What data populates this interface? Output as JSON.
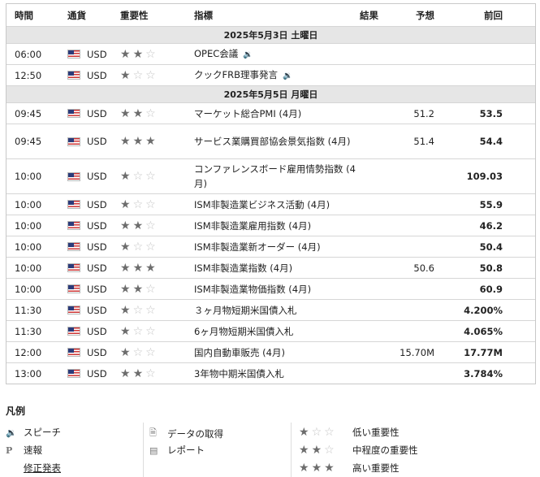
{
  "headers": {
    "time": "時間",
    "currency": "通貨",
    "importance": "重要性",
    "indicator": "指標",
    "result": "結果",
    "forecast": "予想",
    "previous": "前回"
  },
  "groups": [
    {
      "date": "2025年5月3日 土曜日",
      "rows": [
        {
          "time": "06:00",
          "currency": "USD",
          "stars": 2,
          "indicator": "OPEC会議",
          "speech": true,
          "result": "",
          "forecast": "",
          "previous": ""
        },
        {
          "time": "12:50",
          "currency": "USD",
          "stars": 1,
          "indicator": "クックFRB理事発言",
          "speech": true,
          "result": "",
          "forecast": "",
          "previous": ""
        }
      ]
    },
    {
      "date": "2025年5月5日 月曜日",
      "rows": [
        {
          "time": "09:45",
          "currency": "USD",
          "stars": 2,
          "indicator": "マーケット総合PMI (4月)",
          "result": "",
          "forecast": "51.2",
          "previous": "53.5"
        },
        {
          "time": "09:45",
          "currency": "USD",
          "stars": 3,
          "indicator": "サービス業購買部協会景気指数 (4月)",
          "result": "",
          "forecast": "51.4",
          "previous": "54.4",
          "tall": true
        },
        {
          "time": "10:00",
          "currency": "USD",
          "stars": 1,
          "indicator": "コンファレンスボード雇用情勢指数 (4月)",
          "result": "",
          "forecast": "",
          "previous": "109.03",
          "tall": true
        },
        {
          "time": "10:00",
          "currency": "USD",
          "stars": 1,
          "indicator": "ISM非製造業ビジネス活動 (4月)",
          "result": "",
          "forecast": "",
          "previous": "55.9"
        },
        {
          "time": "10:00",
          "currency": "USD",
          "stars": 2,
          "indicator": "ISM非製造業雇用指数 (4月)",
          "result": "",
          "forecast": "",
          "previous": "46.2"
        },
        {
          "time": "10:00",
          "currency": "USD",
          "stars": 1,
          "indicator": "ISM非製造業新オーダー (4月)",
          "result": "",
          "forecast": "",
          "previous": "50.4"
        },
        {
          "time": "10:00",
          "currency": "USD",
          "stars": 3,
          "indicator": "ISM非製造業指数 (4月)",
          "result": "",
          "forecast": "50.6",
          "previous": "50.8"
        },
        {
          "time": "10:00",
          "currency": "USD",
          "stars": 2,
          "indicator": "ISM非製造業物価指数 (4月)",
          "result": "",
          "forecast": "",
          "previous": "60.9"
        },
        {
          "time": "11:30",
          "currency": "USD",
          "stars": 1,
          "indicator": "３ヶ月物短期米国債入札",
          "result": "",
          "forecast": "",
          "previous": "4.200%"
        },
        {
          "time": "11:30",
          "currency": "USD",
          "stars": 1,
          "indicator": "6ヶ月物短期米国債入札",
          "result": "",
          "forecast": "",
          "previous": "4.065%"
        },
        {
          "time": "12:00",
          "currency": "USD",
          "stars": 1,
          "indicator": "国内自動車販売 (4月)",
          "result": "",
          "forecast": "15.70M",
          "previous": "17.77M"
        },
        {
          "time": "13:00",
          "currency": "USD",
          "stars": 2,
          "indicator": "3年物中期米国債入札",
          "result": "",
          "forecast": "",
          "previous": "3.784%"
        }
      ]
    }
  ],
  "legend": {
    "title": "凡例",
    "speech": "スピーチ",
    "preliminary": "速報",
    "revised": "修正発表",
    "data_release": "データの取得",
    "report": "レポート",
    "low": "低い重要性",
    "medium": "中程度の重要性",
    "high": "高い重要性",
    "prelim_mark": "P"
  },
  "icons": {
    "flag": "us-flag-icon",
    "star": "star-icon",
    "speech": "speaker-icon"
  },
  "colors": {
    "star_on": "#6d6d6d",
    "star_off": "#c4c4c4",
    "date_bg": "#e6e6e6"
  }
}
